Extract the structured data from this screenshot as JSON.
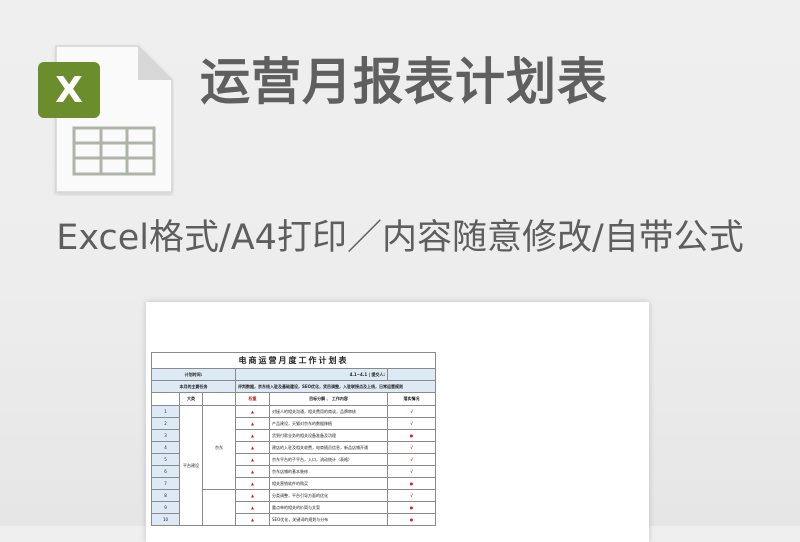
{
  "title": "运营月报表计划表",
  "subtitle": "Excel格式/A4打印／内容随意修改/自带公式",
  "file_icon": {
    "badge_letter": "X",
    "badge_color": "#6b8d2c",
    "grid_color": "#aeb4aa",
    "page_color": "#fafafa"
  },
  "sheet": {
    "title": "电商运营月度工作计划表",
    "plan_time_label": "计划时间:",
    "plan_time_value": "4.1~4.1",
    "submitter_label": "提交人:",
    "main_task_label": "本月的主要任务",
    "main_task_value": "评判数据，京东线入驻及基础建设，SEO优化，货目调整，入驻联接点及上线，日常运营规则",
    "headers": {
      "category": "大类",
      "priority": "权重",
      "goal": "目标分解 、 工作内容",
      "status": "落实情况"
    },
    "category_platform": "平台建设",
    "subcategory_jd": "京东",
    "priority_mark": "▲",
    "rows": [
      {
        "num": "1",
        "content": "对接人的相关沟通，相关费用的商谈，品牌审核",
        "status": "√"
      },
      {
        "num": "2",
        "content": "产品建设，天猫对京东的数据移植",
        "status": "√"
      },
      {
        "num": "3",
        "content": "货到付款业务的相关设备准备及功理",
        "status": "●"
      },
      {
        "num": "4",
        "content": "建店的入驻及相关收费，电商随员信息，新品店铺开通",
        "status": "√"
      },
      {
        "num": "5",
        "content": "京东平台的子平台，入口，流动统计（表格）",
        "status": "√"
      },
      {
        "num": "6",
        "content": "京东店铺的基本装修",
        "status": "√"
      },
      {
        "num": "7",
        "content": "相关营销软件的购买",
        "status": "●"
      },
      {
        "num": "8",
        "content": "分类调整，平台引导方面的优化",
        "status": "√"
      },
      {
        "num": "9",
        "content": "重点单的相关的价简与文案",
        "status": "●"
      },
      {
        "num": "10",
        "content": "SEO优化，关键词的规划与分布",
        "status": "●"
      }
    ]
  }
}
